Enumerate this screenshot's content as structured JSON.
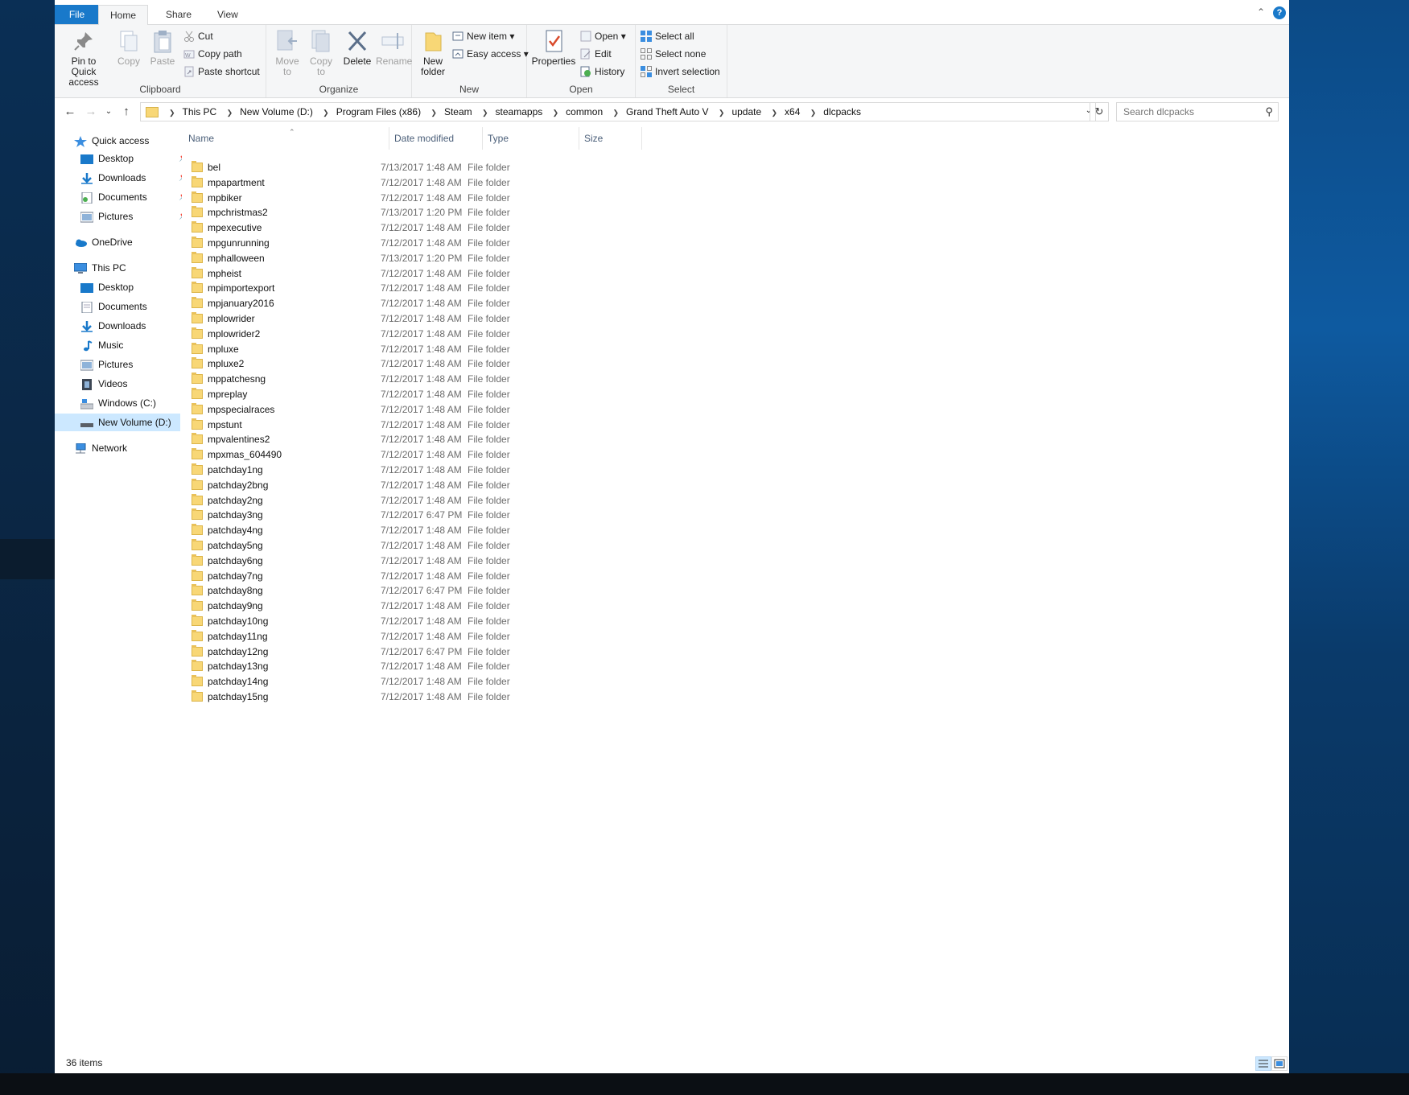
{
  "tabs": {
    "file": "File",
    "home": "Home",
    "share": "Share",
    "view": "View"
  },
  "ribbon": {
    "clipboard": {
      "label": "Clipboard",
      "pin": "Pin to Quick access",
      "copy": "Copy",
      "paste": "Paste",
      "cut": "Cut",
      "copy_path": "Copy path",
      "paste_shortcut": "Paste shortcut"
    },
    "organize": {
      "label": "Organize",
      "move_to": "Move to",
      "copy_to": "Copy to",
      "delete": "Delete",
      "rename": "Rename"
    },
    "new": {
      "label": "New",
      "new_folder": "New folder",
      "new_item": "New item",
      "easy_access": "Easy access"
    },
    "open": {
      "label": "Open",
      "properties": "Properties",
      "open": "Open",
      "edit": "Edit",
      "history": "History"
    },
    "select": {
      "label": "Select",
      "select_all": "Select all",
      "select_none": "Select none",
      "invert": "Invert selection"
    }
  },
  "address": {
    "crumbs": [
      "This PC",
      "New Volume (D:)",
      "Program Files (x86)",
      "Steam",
      "steamapps",
      "common",
      "Grand Theft Auto V",
      "update",
      "x64",
      "dlcpacks"
    ]
  },
  "search": {
    "placeholder": "Search dlcpacks"
  },
  "navpane": {
    "quick_access": "Quick access",
    "quick_items": [
      "Desktop",
      "Downloads",
      "Documents",
      "Pictures"
    ],
    "onedrive": "OneDrive",
    "this_pc": "This PC",
    "pc_items": [
      "Desktop",
      "Documents",
      "Downloads",
      "Music",
      "Pictures",
      "Videos",
      "Windows (C:)",
      "New Volume (D:)"
    ],
    "network": "Network"
  },
  "columns": {
    "name": "Name",
    "date": "Date modified",
    "type": "Type",
    "size": "Size"
  },
  "files": [
    {
      "name": "bel",
      "date": "7/13/2017 1:48 AM",
      "type": "File folder"
    },
    {
      "name": "mpapartment",
      "date": "7/12/2017 1:48 AM",
      "type": "File folder"
    },
    {
      "name": "mpbiker",
      "date": "7/12/2017 1:48 AM",
      "type": "File folder"
    },
    {
      "name": "mpchristmas2",
      "date": "7/13/2017 1:20 PM",
      "type": "File folder"
    },
    {
      "name": "mpexecutive",
      "date": "7/12/2017 1:48 AM",
      "type": "File folder"
    },
    {
      "name": "mpgunrunning",
      "date": "7/12/2017 1:48 AM",
      "type": "File folder"
    },
    {
      "name": "mphalloween",
      "date": "7/13/2017 1:20 PM",
      "type": "File folder"
    },
    {
      "name": "mpheist",
      "date": "7/12/2017 1:48 AM",
      "type": "File folder"
    },
    {
      "name": "mpimportexport",
      "date": "7/12/2017 1:48 AM",
      "type": "File folder"
    },
    {
      "name": "mpjanuary2016",
      "date": "7/12/2017 1:48 AM",
      "type": "File folder"
    },
    {
      "name": "mplowrider",
      "date": "7/12/2017 1:48 AM",
      "type": "File folder"
    },
    {
      "name": "mplowrider2",
      "date": "7/12/2017 1:48 AM",
      "type": "File folder"
    },
    {
      "name": "mpluxe",
      "date": "7/12/2017 1:48 AM",
      "type": "File folder"
    },
    {
      "name": "mpluxe2",
      "date": "7/12/2017 1:48 AM",
      "type": "File folder"
    },
    {
      "name": "mppatchesng",
      "date": "7/12/2017 1:48 AM",
      "type": "File folder"
    },
    {
      "name": "mpreplay",
      "date": "7/12/2017 1:48 AM",
      "type": "File folder"
    },
    {
      "name": "mpspecialraces",
      "date": "7/12/2017 1:48 AM",
      "type": "File folder"
    },
    {
      "name": "mpstunt",
      "date": "7/12/2017 1:48 AM",
      "type": "File folder"
    },
    {
      "name": "mpvalentines2",
      "date": "7/12/2017 1:48 AM",
      "type": "File folder"
    },
    {
      "name": "mpxmas_604490",
      "date": "7/12/2017 1:48 AM",
      "type": "File folder"
    },
    {
      "name": "patchday1ng",
      "date": "7/12/2017 1:48 AM",
      "type": "File folder"
    },
    {
      "name": "patchday2bng",
      "date": "7/12/2017 1:48 AM",
      "type": "File folder"
    },
    {
      "name": "patchday2ng",
      "date": "7/12/2017 1:48 AM",
      "type": "File folder"
    },
    {
      "name": "patchday3ng",
      "date": "7/12/2017 6:47 PM",
      "type": "File folder"
    },
    {
      "name": "patchday4ng",
      "date": "7/12/2017 1:48 AM",
      "type": "File folder"
    },
    {
      "name": "patchday5ng",
      "date": "7/12/2017 1:48 AM",
      "type": "File folder"
    },
    {
      "name": "patchday6ng",
      "date": "7/12/2017 1:48 AM",
      "type": "File folder"
    },
    {
      "name": "patchday7ng",
      "date": "7/12/2017 1:48 AM",
      "type": "File folder"
    },
    {
      "name": "patchday8ng",
      "date": "7/12/2017 6:47 PM",
      "type": "File folder"
    },
    {
      "name": "patchday9ng",
      "date": "7/12/2017 1:48 AM",
      "type": "File folder"
    },
    {
      "name": "patchday10ng",
      "date": "7/12/2017 1:48 AM",
      "type": "File folder"
    },
    {
      "name": "patchday11ng",
      "date": "7/12/2017 1:48 AM",
      "type": "File folder"
    },
    {
      "name": "patchday12ng",
      "date": "7/12/2017 6:47 PM",
      "type": "File folder"
    },
    {
      "name": "patchday13ng",
      "date": "7/12/2017 1:48 AM",
      "type": "File folder"
    },
    {
      "name": "patchday14ng",
      "date": "7/12/2017 1:48 AM",
      "type": "File folder"
    },
    {
      "name": "patchday15ng",
      "date": "7/12/2017 1:48 AM",
      "type": "File folder"
    }
  ],
  "status": {
    "count": "36 items"
  },
  "colors": {
    "accent": "#1979ca",
    "folder": "#f8d776",
    "selected": "#cce8ff"
  }
}
